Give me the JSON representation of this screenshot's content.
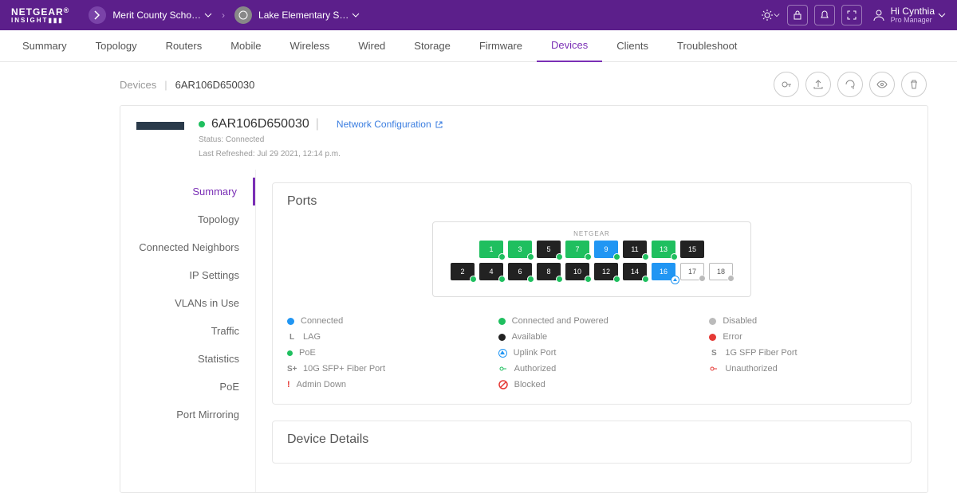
{
  "topbar": {
    "brand": "NETGEAR",
    "brand_sub": "INSIGHT▮▮▮",
    "org1": "Merit County Scho…",
    "org2": "Lake Elementary S…",
    "user_greeting": "Hi Cynthia",
    "user_role": "Pro Manager"
  },
  "nav": {
    "tabs": [
      "Summary",
      "Topology",
      "Routers",
      "Mobile",
      "Wireless",
      "Wired",
      "Storage",
      "Firmware",
      "Devices",
      "Clients",
      "Troubleshoot"
    ],
    "active": "Devices"
  },
  "crumb": {
    "root": "Devices",
    "current": "6AR106D650030"
  },
  "device": {
    "name": "6AR106D650030",
    "net_config": "Network Configuration",
    "status": "Status: Connected",
    "refreshed": "Last Refreshed: Jul 29 2021, 12:14 p.m."
  },
  "sidetabs": [
    "Summary",
    "Topology",
    "Connected Neighbors",
    "IP Settings",
    "VLANs in Use",
    "Traffic",
    "Statistics",
    "PoE",
    "Port Mirroring"
  ],
  "sidetab_active": "Summary",
  "ports_card": {
    "title": "Ports",
    "switch_brand": "NETGEAR",
    "top_row": [
      {
        "n": "1",
        "c": "green",
        "poe": true
      },
      {
        "n": "3",
        "c": "green",
        "poe": true
      },
      {
        "n": "5",
        "c": "black",
        "poe": true
      },
      {
        "n": "7",
        "c": "green",
        "poe": true
      },
      {
        "n": "9",
        "c": "blue",
        "poe": true
      },
      {
        "n": "11",
        "c": "black",
        "poe": true
      },
      {
        "n": "13",
        "c": "green",
        "poe": true
      },
      {
        "n": "15",
        "c": "black"
      }
    ],
    "bottom_row": [
      {
        "n": "2",
        "c": "black",
        "poe": true
      },
      {
        "n": "4",
        "c": "black",
        "poe": true
      },
      {
        "n": "6",
        "c": "black",
        "poe": true
      },
      {
        "n": "8",
        "c": "black",
        "poe": true
      },
      {
        "n": "10",
        "c": "black",
        "poe": true
      },
      {
        "n": "12",
        "c": "black",
        "poe": true
      },
      {
        "n": "14",
        "c": "black",
        "poe": true
      },
      {
        "n": "16",
        "c": "blue",
        "uplink": true
      },
      {
        "n": "17",
        "c": "white",
        "disabled": true
      },
      {
        "n": "18",
        "c": "white",
        "disabled": true
      }
    ],
    "legend": [
      {
        "icon": "dot",
        "color": "#2196f3",
        "label": "Connected"
      },
      {
        "icon": "dot",
        "color": "#1fbf5f",
        "label": "Connected and Powered"
      },
      {
        "icon": "dot",
        "color": "#bbb",
        "label": "Disabled"
      },
      {
        "icon": "text",
        "txt": "L",
        "label": "LAG"
      },
      {
        "icon": "dot",
        "color": "#222",
        "label": "Available"
      },
      {
        "icon": "dot",
        "color": "#e53935",
        "label": "Error"
      },
      {
        "icon": "poe",
        "label": "PoE"
      },
      {
        "icon": "uplink",
        "label": "Uplink Port"
      },
      {
        "icon": "text",
        "txt": "S",
        "label": "1G SFP Fiber Port"
      },
      {
        "icon": "text",
        "txt": "S+",
        "label": "10G SFP+ Fiber Port"
      },
      {
        "icon": "auth",
        "label": "Authorized"
      },
      {
        "icon": "unauth",
        "label": "Unauthorized"
      },
      {
        "icon": "admindown",
        "label": "Admin Down"
      },
      {
        "icon": "blocked",
        "label": "Blocked"
      }
    ]
  },
  "details_card": {
    "title": "Device Details"
  }
}
